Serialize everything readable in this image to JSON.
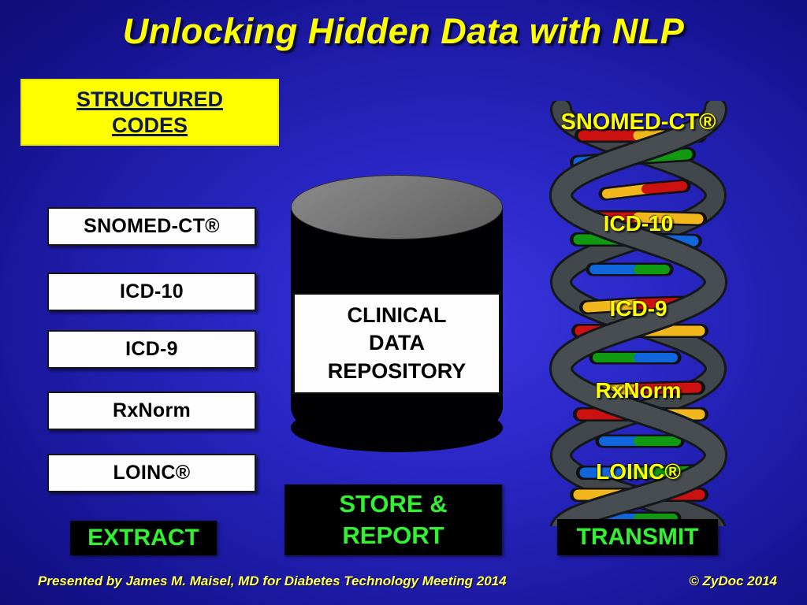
{
  "slide": {
    "title": "Unlocking Hidden Data with NLP",
    "background_color": "#2a27c6",
    "title_color": "#ffff00"
  },
  "left_panel": {
    "heading_line1": "STRUCTURED",
    "heading_line2": "CODES",
    "heading_bg_color": "#ffff00",
    "heading_text_color": "#0d1a4d",
    "codes": [
      {
        "label": "SNOMED-CT®"
      },
      {
        "label": "ICD-10"
      },
      {
        "label": "ICD-9"
      },
      {
        "label": "RxNorm"
      },
      {
        "label": "LOINC®"
      }
    ],
    "action": "EXTRACT",
    "action_text_color": "#33f033",
    "action_bg_color": "#000000"
  },
  "center_panel": {
    "repository_line1": "CLINICAL",
    "repository_line2": "DATA",
    "repository_line3": "REPOSITORY",
    "action_line1": "STORE &",
    "action_line2": "REPORT",
    "cylinder_body_color": "#010103",
    "cylinder_top_color": "#707070"
  },
  "right_panel": {
    "action": "TRANSMIT",
    "dna_labels": [
      {
        "label": "SNOMED-CT®"
      },
      {
        "label": "ICD-10"
      },
      {
        "label": "ICD-9"
      },
      {
        "label": "RxNorm"
      },
      {
        "label": "LOINC®"
      }
    ],
    "dna_strand_color": "#3f4448",
    "base_pair_colors": [
      "#cc1111",
      "#f2b71c",
      "#1166dd",
      "#119911"
    ]
  },
  "footer": {
    "presented_by": "Presented by James M. Maisel, MD for Diabetes Technology Meeting 2014",
    "copyright": "© ZyDoc 2014"
  }
}
